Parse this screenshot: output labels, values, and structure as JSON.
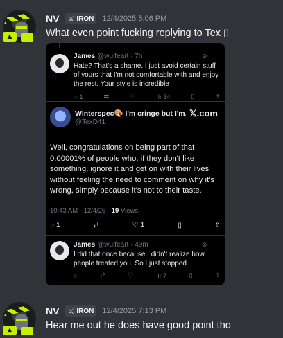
{
  "messages": [
    {
      "username": "NV",
      "tag": "IRON",
      "timestamp": "12/4/2025 5:06 PM",
      "content": "What even point fucking replying to Tex ▯"
    },
    {
      "username": "NV",
      "tag": "IRON",
      "timestamp": "12/4/2025 7:13 PM",
      "content": "Hear me out he does have good point tho"
    }
  ],
  "embed": {
    "source": "𝕏.com",
    "parent_tweet": {
      "name": "James",
      "handle": "@wulfeart · 7h",
      "text": "Hate? That's a shame. I just avoid certain stuff of yours that I'm not comfortable with and enjoy the rest. Your style is incredible",
      "replies": "1",
      "views": "34"
    },
    "main_tweet": {
      "name": "Winterspec🎨 I'm cringe but I'm...",
      "handle": "@TexD41",
      "text": "Well, congratulations on being part of that 0.00001% of people who, if they don't like something, ignore it and get on with their lives without feeling the need to comment on why it's wrong, simply because it's not to their taste.",
      "time": "10:43 AM · 12/4/25 · ",
      "views_count": "19",
      "views_label": " Views",
      "replies": "1",
      "likes": "1"
    },
    "reply_tweet": {
      "name": "James",
      "handle": "@wulfeart · 49m",
      "text": "I did that once because I didn't realize how people treated you. So I just stopped.",
      "views": "7"
    }
  },
  "icons": {
    "reply": "○",
    "retweet": "⇄",
    "like": "♡",
    "views": "ılı",
    "bookmark": "▯",
    "share": "⇧",
    "grok": "⊘",
    "more": "···",
    "sword": "⚔"
  }
}
